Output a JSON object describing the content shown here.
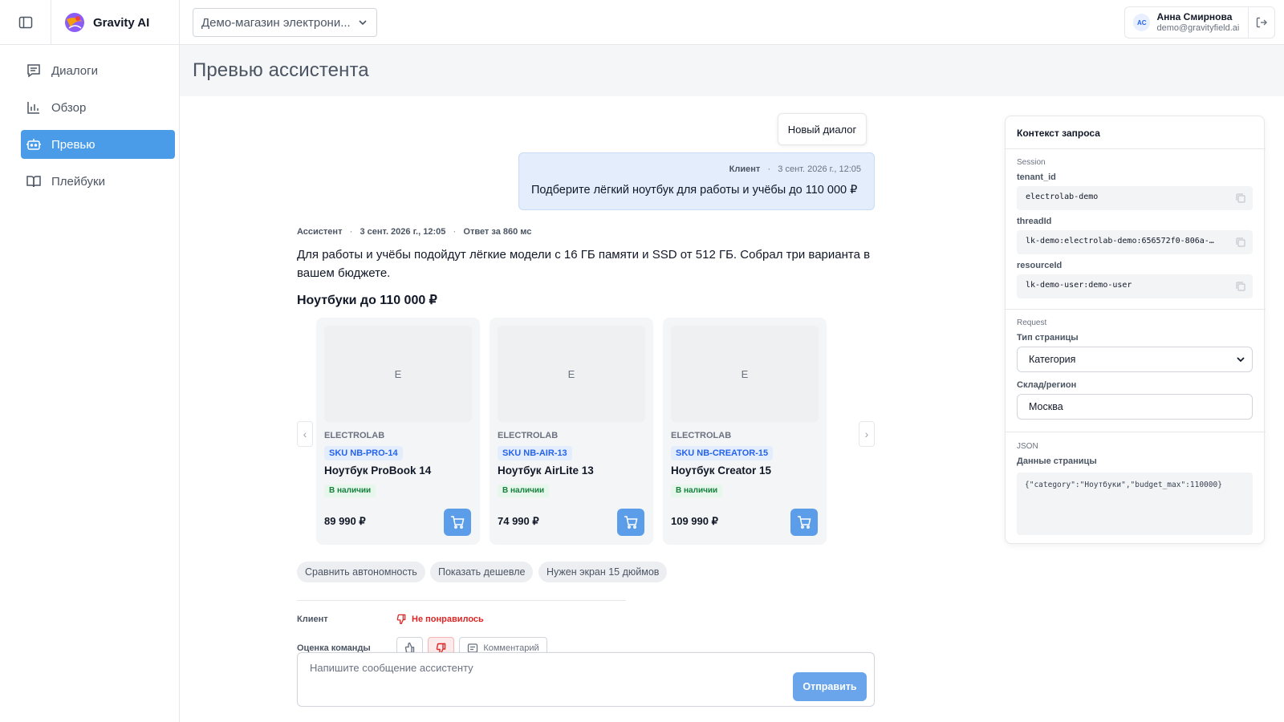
{
  "header": {
    "brand": "Gravity AI",
    "store_select": "Демо-магазин электрони...",
    "user": {
      "initials": "AC",
      "name": "Анна Смирнова",
      "email": "demo@gravityfield.ai"
    }
  },
  "sidebar": {
    "items": [
      {
        "label": "Диалоги",
        "icon": "dialogs-icon"
      },
      {
        "label": "Обзор",
        "icon": "chart-icon"
      },
      {
        "label": "Превью",
        "icon": "bot-icon",
        "active": true
      },
      {
        "label": "Плейбуки",
        "icon": "book-icon"
      }
    ]
  },
  "page": {
    "title": "Превью ассистента",
    "new_dialog": "Новый диалог"
  },
  "messages": {
    "user": {
      "author": "Клиент",
      "sep": "·",
      "time": "3 сент. 2026 г., 12:05",
      "text": "Подберите лёгкий ноутбук для работы и учёбы до 110 000 ₽"
    },
    "assistant": {
      "author": "Ассистент",
      "sep": "·",
      "time": "3 сент. 2026 г., 12:05",
      "latency": "Ответ за 860 мс",
      "text": "Для работы и учёбы подойдут лёгкие модели с 16 ГБ памяти и SSD от 512 ГБ. Собрал три варианта в вашем бюджете.",
      "heading": "Ноутбуки до 110 000 ₽"
    }
  },
  "carousel": {
    "prev": "‹",
    "next": "›",
    "products": [
      {
        "image_letter": "E",
        "brand": "ELECTROLAB",
        "sku": "SKU NB-PRO-14",
        "name": "Ноутбук ProBook 14",
        "stock": "В наличии",
        "price": "89 990 ₽"
      },
      {
        "image_letter": "E",
        "brand": "ELECTROLAB",
        "sku": "SKU NB-AIR-13",
        "name": "Ноутбук AirLite 13",
        "stock": "В наличии",
        "price": "74 990 ₽"
      },
      {
        "image_letter": "E",
        "brand": "ELECTROLAB",
        "sku": "SKU NB-CREATOR-15",
        "name": "Ноутбук Creator 15",
        "stock": "В наличии",
        "price": "109 990 ₽"
      }
    ]
  },
  "suggestions": [
    "Сравнить автономность",
    "Показать дешевле",
    "Нужен экран 15 дюймов"
  ],
  "feedback": {
    "client_label": "Клиент",
    "client_value": "Не понравилось",
    "team_label": "Оценка команды",
    "comment": "Комментарий"
  },
  "composer": {
    "placeholder": "Напишите сообщение ассистенту",
    "send": "Отправить"
  },
  "context": {
    "title": "Контекст запроса",
    "session_section": "Session",
    "tenant_label": "tenant_id",
    "tenant_value": "electrolab-demo",
    "thread_label": "threadId",
    "thread_value": "lk-demo:electrolab-demo:656572f0-806a-…",
    "resource_label": "resourceId",
    "resource_value": "lk-demo-user:demo-user",
    "request_section": "Request",
    "page_type_label": "Тип страницы",
    "page_type_value": "Категория",
    "region_label": "Склад/регион",
    "region_value": "Москва",
    "json_section": "JSON",
    "page_data_label": "Данные страницы",
    "page_data_value": "{\"category\":\"Ноутбуки\",\"budget_max\":110000}"
  },
  "colors": {
    "accent": "#4a9ce8",
    "user_bubble": "#e3edfc",
    "sku_badge": "#2563eb",
    "in_stock": "#15803d",
    "dislike": "#dc2626",
    "send_button": "#6aa5ec"
  }
}
